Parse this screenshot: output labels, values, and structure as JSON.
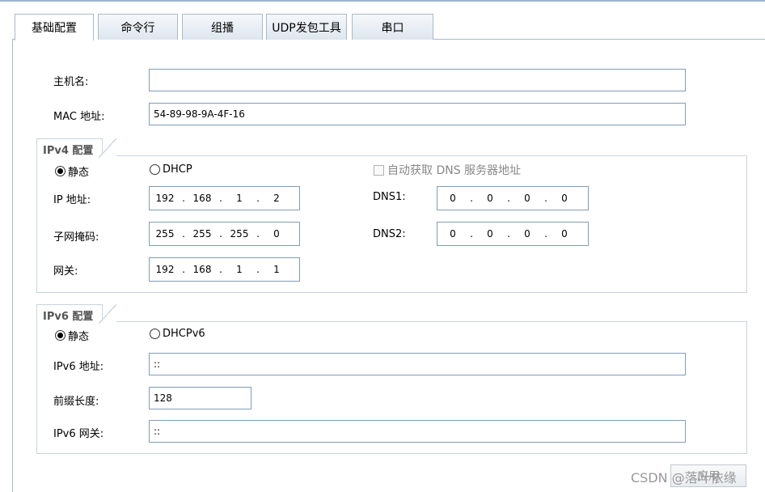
{
  "tabs": [
    "基础配置",
    "命令行",
    "组播",
    "UDP发包工具",
    "串口"
  ],
  "basic": {
    "hostname_label": "主机名:",
    "hostname_value": "",
    "mac_label": "MAC 地址:",
    "mac_value": "54-89-98-9A-4F-16"
  },
  "ipv4": {
    "section_title": "IPv4 配置",
    "static_label": "静态",
    "dhcp_label": "DHCP",
    "auto_dns_label": "自动获取 DNS 服务器地址",
    "ip_label": "IP 地址:",
    "ip_value": [
      "192",
      "168",
      "1",
      "2"
    ],
    "mask_label": "子网掩码:",
    "mask_value": [
      "255",
      "255",
      "255",
      "0"
    ],
    "gateway_label": "网关:",
    "gateway_value": [
      "192",
      "168",
      "1",
      "1"
    ],
    "dns1_label": "DNS1:",
    "dns1_value": [
      "0",
      "0",
      "0",
      "0"
    ],
    "dns2_label": "DNS2:",
    "dns2_value": [
      "0",
      "0",
      "0",
      "0"
    ],
    "selected_mode": "静态"
  },
  "ipv6": {
    "section_title": "IPv6 配置",
    "static_label": "静态",
    "dhcp_label": "DHCPv6",
    "addr_label": "IPv6 地址:",
    "addr_value": "::",
    "prefix_label": "前缀长度:",
    "prefix_value": "128",
    "gateway_label": "IPv6 网关:",
    "gateway_value": "::",
    "selected_mode": "静态"
  },
  "footer": {
    "apply_label": "应用",
    "watermark": "CSDN @落叶依缘"
  }
}
